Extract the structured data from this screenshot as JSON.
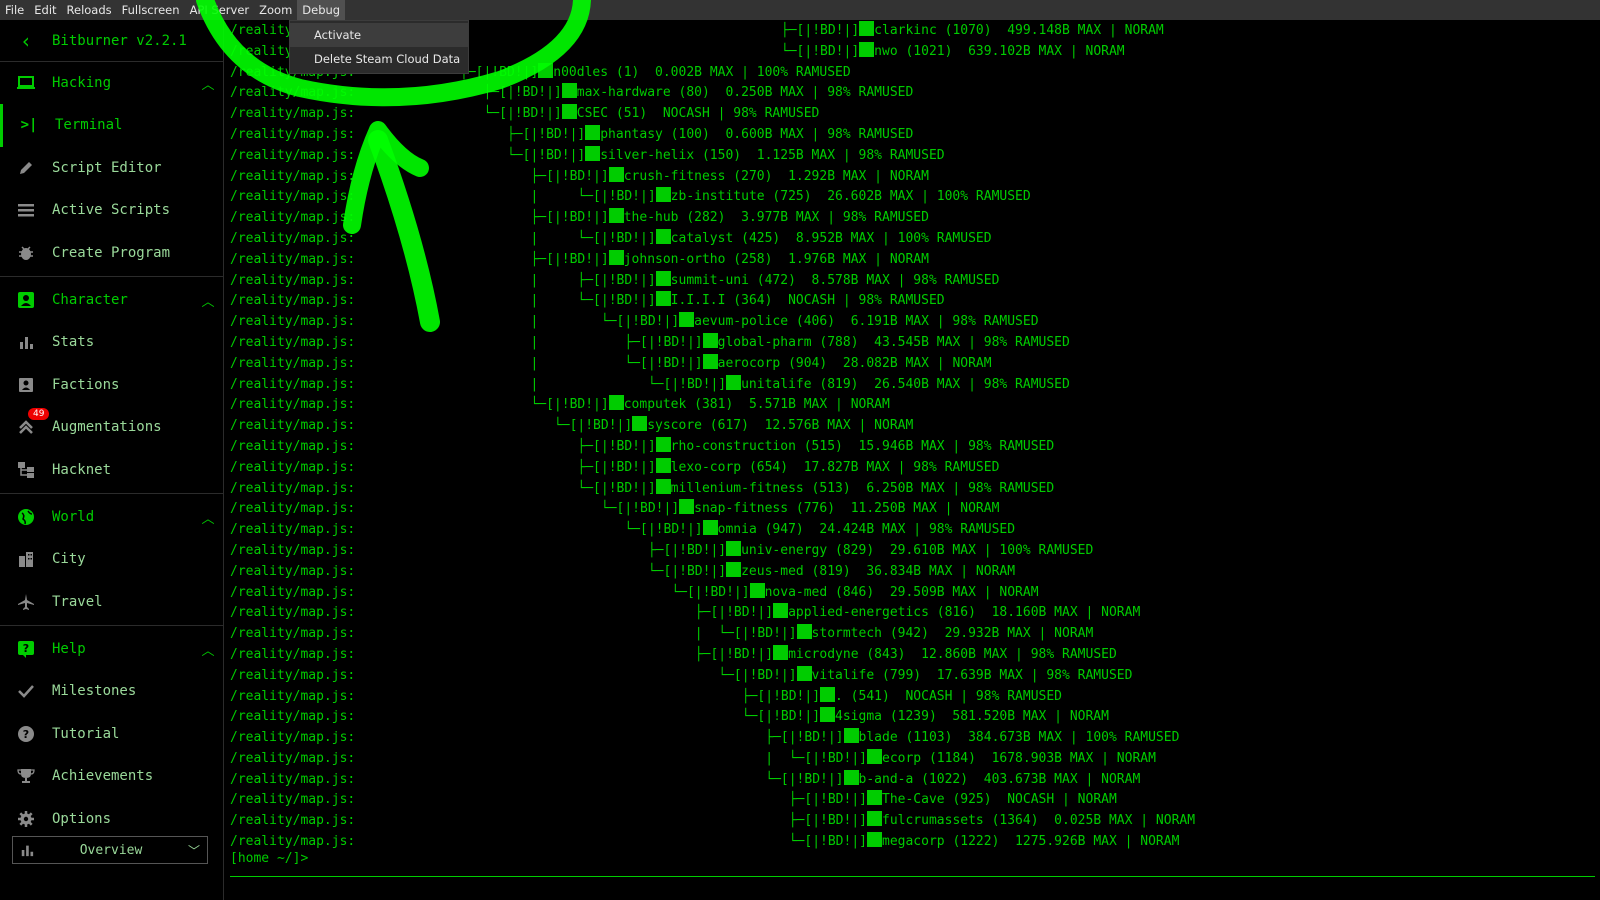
{
  "menubar": [
    "File",
    "Edit",
    "Reloads",
    "Fullscreen",
    "API Server",
    "Zoom",
    "Debug"
  ],
  "dropdown": [
    "Activate",
    "Delete Steam Cloud Data"
  ],
  "sidebar": {
    "version": "Bitburner v2.2.1",
    "sections": [
      {
        "label": "Hacking",
        "items": [
          "Terminal",
          "Script Editor",
          "Active Scripts",
          "Create Program"
        ]
      },
      {
        "label": "Character",
        "items": [
          "Stats",
          "Factions",
          "Augmentations",
          "Hacknet"
        ]
      },
      {
        "label": "World",
        "items": [
          "City",
          "Travel"
        ]
      },
      {
        "label": "Help",
        "items": [
          "Milestones",
          "Tutorial",
          "Achievements",
          "Options"
        ]
      }
    ],
    "augmentations_badge": "49",
    "overview": "Overview"
  },
  "terminal": {
    "prompt": "[home ~/]>",
    "lines": [
      {
        "prefix": "/reality",
        "tree": "                                         ├─[|!BD!|]",
        "text": "clarkinc (1070)  499.148B MAX | NORAM"
      },
      {
        "prefix": "/reality",
        "tree": "                                         └─[|!BD!|]",
        "text": "nwo (1021)  639.102B MAX | NORAM"
      },
      {
        "prefix": "/reality/map.js:",
        "tree": "├─[|!BD!|]",
        "text": "n00dles (1)  0.002B MAX | 100% RAMUSED"
      },
      {
        "prefix": "/reality/map.js:",
        "tree": "   ├─[|!BD!|]",
        "text": "max-hardware (80)  0.250B MAX | 98% RAMUSED"
      },
      {
        "prefix": "/reality/map.js:",
        "tree": "   └─[|!BD!|]",
        "text": "CSEC (51)  NOCASH | 98% RAMUSED"
      },
      {
        "prefix": "/reality/map.js:",
        "tree": "      ├─[|!BD!|]",
        "text": "phantasy (100)  0.600B MAX | 98% RAMUSED"
      },
      {
        "prefix": "/reality/map.js:",
        "tree": "      └─[|!BD!|]",
        "text": "silver-helix (150)  1.125B MAX | 98% RAMUSED"
      },
      {
        "prefix": "/reality/map.js:",
        "tree": "         ├─[|!BD!|]",
        "text": "crush-fitness (270)  1.292B MAX | NORAM"
      },
      {
        "prefix": "/reality/map.js:",
        "tree": "         |     └─[|!BD!|]",
        "text": "zb-institute (725)  26.602B MAX | 100% RAMUSED"
      },
      {
        "prefix": "/reality/map.js:",
        "tree": "         ├─[|!BD!|]",
        "text": "the-hub (282)  3.977B MAX | 98% RAMUSED"
      },
      {
        "prefix": "/reality/map.js:",
        "tree": "         |     └─[|!BD!|]",
        "text": "catalyst (425)  8.952B MAX | 100% RAMUSED"
      },
      {
        "prefix": "/reality/map.js:",
        "tree": "         ├─[|!BD!|]",
        "text": "johnson-ortho (258)  1.976B MAX | NORAM"
      },
      {
        "prefix": "/reality/map.js:",
        "tree": "         |     ├─[|!BD!|]",
        "text": "summit-uni (472)  8.578B MAX | 98% RAMUSED"
      },
      {
        "prefix": "/reality/map.js:",
        "tree": "         |     └─[|!BD!|]",
        "text": "I.I.I.I (364)  NOCASH | 98% RAMUSED"
      },
      {
        "prefix": "/reality/map.js:",
        "tree": "         |        └─[|!BD!|]",
        "text": "aevum-police (406)  6.191B MAX | 98% RAMUSED"
      },
      {
        "prefix": "/reality/map.js:",
        "tree": "         |           ├─[|!BD!|]",
        "text": "global-pharm (788)  43.545B MAX | 98% RAMUSED"
      },
      {
        "prefix": "/reality/map.js:",
        "tree": "         |           └─[|!BD!|]",
        "text": "aerocorp (904)  28.082B MAX | NORAM"
      },
      {
        "prefix": "/reality/map.js:",
        "tree": "         |              └─[|!BD!|]",
        "text": "unitalife (819)  26.540B MAX | 98% RAMUSED"
      },
      {
        "prefix": "/reality/map.js:",
        "tree": "         └─[|!BD!|]",
        "text": "computek (381)  5.571B MAX | NORAM"
      },
      {
        "prefix": "/reality/map.js:",
        "tree": "            └─[|!BD!|]",
        "text": "syscore (617)  12.576B MAX | NORAM"
      },
      {
        "prefix": "/reality/map.js:",
        "tree": "               ├─[|!BD!|]",
        "text": "rho-construction (515)  15.946B MAX | 98% RAMUSED"
      },
      {
        "prefix": "/reality/map.js:",
        "tree": "               ├─[|!BD!|]",
        "text": "lexo-corp (654)  17.827B MAX | 98% RAMUSED"
      },
      {
        "prefix": "/reality/map.js:",
        "tree": "               └─[|!BD!|]",
        "text": "millenium-fitness (513)  6.250B MAX | 98% RAMUSED"
      },
      {
        "prefix": "/reality/map.js:",
        "tree": "                  └─[|!BD!|]",
        "text": "snap-fitness (776)  11.250B MAX | NORAM"
      },
      {
        "prefix": "/reality/map.js:",
        "tree": "                     └─[|!BD!|]",
        "text": "omnia (947)  24.424B MAX | 98% RAMUSED"
      },
      {
        "prefix": "/reality/map.js:",
        "tree": "                        ├─[|!BD!|]",
        "text": "univ-energy (829)  29.610B MAX | 100% RAMUSED"
      },
      {
        "prefix": "/reality/map.js:",
        "tree": "                        └─[|!BD!|]",
        "text": "zeus-med (819)  36.834B MAX | NORAM"
      },
      {
        "prefix": "/reality/map.js:",
        "tree": "                           └─[|!BD!|]",
        "text": "nova-med (846)  29.509B MAX | NORAM"
      },
      {
        "prefix": "/reality/map.js:",
        "tree": "                              ├─[|!BD!|]",
        "text": "applied-energetics (816)  18.160B MAX | NORAM"
      },
      {
        "prefix": "/reality/map.js:",
        "tree": "                              |  └─[|!BD!|]",
        "text": "stormtech (942)  29.932B MAX | NORAM"
      },
      {
        "prefix": "/reality/map.js:",
        "tree": "                              ├─[|!BD!|]",
        "text": "microdyne (843)  12.860B MAX | 98% RAMUSED"
      },
      {
        "prefix": "/reality/map.js:",
        "tree": "                                 └─[|!BD!|]",
        "text": "vitalife (799)  17.639B MAX | 98% RAMUSED"
      },
      {
        "prefix": "/reality/map.js:",
        "tree": "                                    ├─[|!BD!|]",
        "text": ". (541)  NOCASH | 98% RAMUSED"
      },
      {
        "prefix": "/reality/map.js:",
        "tree": "                                    └─[|!BD!|]",
        "text": "4sigma (1239)  581.520B MAX | NORAM"
      },
      {
        "prefix": "/reality/map.js:",
        "tree": "                                       ├─[|!BD!|]",
        "text": "blade (1103)  384.673B MAX | 100% RAMUSED"
      },
      {
        "prefix": "/reality/map.js:",
        "tree": "                                       |  └─[|!BD!|]",
        "text": "ecorp (1184)  1678.903B MAX | NORAM"
      },
      {
        "prefix": "/reality/map.js:",
        "tree": "                                       └─[|!BD!|]",
        "text": "b-and-a (1022)  403.673B MAX | NORAM"
      },
      {
        "prefix": "/reality/map.js:",
        "tree": "                                          ├─[|!BD!|]",
        "text": "The-Cave (925)  NOCASH | NORAM"
      },
      {
        "prefix": "/reality/map.js:",
        "tree": "                                          ├─[|!BD!|]",
        "text": "fulcrumassets (1364)  0.025B MAX | NORAM"
      },
      {
        "prefix": "/reality/map.js:",
        "tree": "                                          └─[|!BD!|]",
        "text": "megacorp (1222)  1275.926B MAX | NORAM"
      }
    ]
  },
  "colors": {
    "terminal_green": "#00cc00",
    "sidebar_text": "#9ad99a",
    "menubar_bg": "#333333",
    "annotation": "#00ff00",
    "badge": "#ee0000"
  },
  "icons": [
    "chevron-left-icon",
    "laptop-icon",
    "terminal-icon",
    "pencil-icon",
    "list-icon",
    "bug-icon",
    "person-card-icon",
    "bar-chart-icon",
    "contacts-icon",
    "double-chevron-up-icon",
    "hacknet-icon",
    "globe-icon",
    "city-icon",
    "airplane-icon",
    "help-box-icon",
    "check-icon",
    "help-circle-icon",
    "trophy-icon",
    "gear-icon",
    "chevron-up-icon",
    "chevron-down-icon"
  ]
}
